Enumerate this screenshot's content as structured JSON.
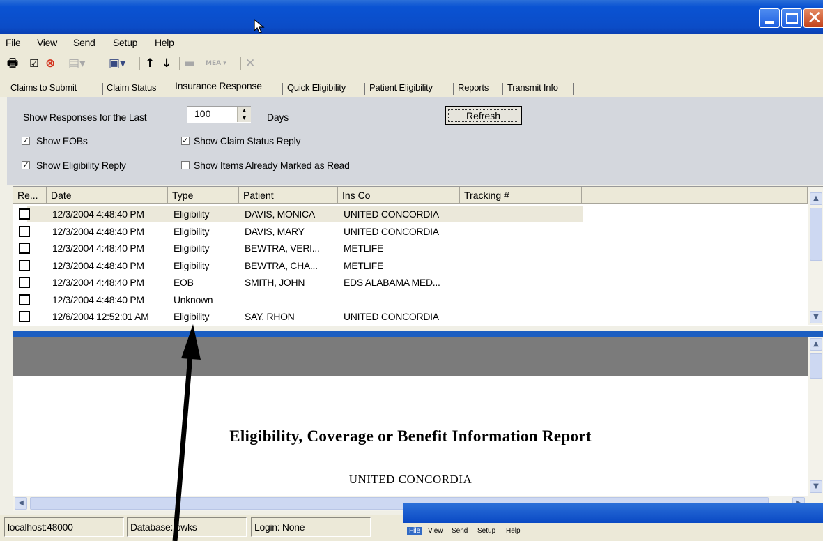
{
  "menu": [
    "File",
    "View",
    "Send",
    "Setup",
    "Help"
  ],
  "toolbar": {
    "icons": [
      "print-icon",
      "check-icon",
      "stop-icon",
      "batch-icon",
      "computer-icon",
      "up-arrow-icon",
      "down-arrow-icon",
      "minus-icon",
      "mea-icon",
      "delete-icon"
    ],
    "mea_label": "MEA"
  },
  "tabs": [
    "Claims to Submit",
    "Claim Status",
    "Insurance Response",
    "Quick Eligibility",
    "Patient Eligibility",
    "Reports",
    "Transmit Info"
  ],
  "active_tab": "Insurance Response",
  "options": {
    "show_last_label": "Show Responses for the Last",
    "days_value": "100",
    "days_label": "Days",
    "refresh_label": "Refresh",
    "show_eobs": {
      "label": "Show EOBs",
      "checked": true
    },
    "show_claim_status": {
      "label": "Show Claim Status Reply",
      "checked": true
    },
    "show_eligibility": {
      "label": "Show Eligibility Reply",
      "checked": true
    },
    "show_read": {
      "label": "Show Items Already Marked as Read",
      "checked": false
    }
  },
  "grid": {
    "columns": [
      "Re...",
      "Date",
      "Type",
      "Patient",
      "Ins Co",
      "Tracking #"
    ],
    "rows": [
      {
        "date": "12/3/2004 4:48:40 PM",
        "type": "Eligibility",
        "patient": "DAVIS, MONICA",
        "insco": "UNITED CONCORDIA",
        "tracking": ""
      },
      {
        "date": "12/3/2004 4:48:40 PM",
        "type": "Eligibility",
        "patient": "DAVIS, MARY",
        "insco": "UNITED CONCORDIA",
        "tracking": ""
      },
      {
        "date": "12/3/2004 4:48:40 PM",
        "type": "Eligibility",
        "patient": "BEWTRA, VERI...",
        "insco": "METLIFE",
        "tracking": ""
      },
      {
        "date": "12/3/2004 4:48:40 PM",
        "type": "Eligibility",
        "patient": "BEWTRA, CHA...",
        "insco": "METLIFE",
        "tracking": ""
      },
      {
        "date": "12/3/2004 4:48:40 PM",
        "type": "EOB",
        "patient": "SMITH, JOHN",
        "insco": "EDS ALABAMA MED...",
        "tracking": ""
      },
      {
        "date": "12/3/2004 4:48:40 PM",
        "type": "Unknown",
        "patient": "",
        "insco": "",
        "tracking": ""
      },
      {
        "date": "12/6/2004 12:52:01 AM",
        "type": "Eligibility",
        "patient": "SAY, RHON",
        "insco": "UNITED CONCORDIA",
        "tracking": ""
      }
    ]
  },
  "report": {
    "title": "Eligibility, Coverage or Benefit Information Report",
    "payer": "UNITED CONCORDIA"
  },
  "status": {
    "host": "localhost:48000",
    "database": "Database: pwks",
    "login": "Login: None"
  },
  "second_window": {
    "menu": [
      "File",
      "View",
      "Send",
      "Setup",
      "Help"
    ]
  },
  "colors": {
    "titlebar": "#0b4cc7",
    "options_panel": "#d4d7dd",
    "splitter": "#1c5ec1",
    "report_band": "#7b7b7b"
  }
}
